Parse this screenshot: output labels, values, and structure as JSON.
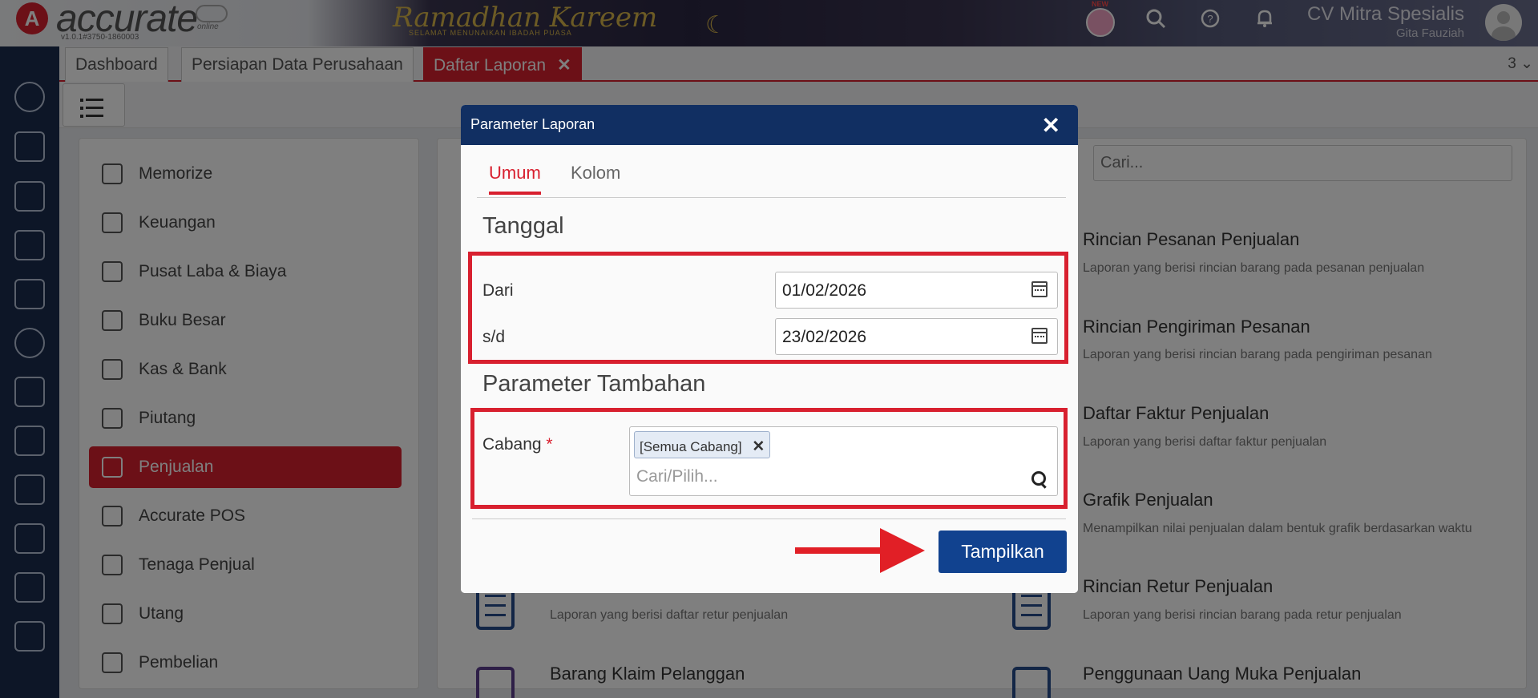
{
  "app": {
    "logo_text": "accurate",
    "logo_sub": "online",
    "version": "v1.0.1#3750-1860003",
    "banner_title": "Ramadhan Kareem",
    "banner_subtitle": "SELAMAT MENUNAIKAN IBADAH PUASA",
    "new_badge": "NEW",
    "company": "CV Mitra Spesialis",
    "user": "Gita Fauziah"
  },
  "tabs": [
    {
      "label": "Dashboard"
    },
    {
      "label": "Persiapan Data Perusahaan"
    },
    {
      "label": "Daftar Laporan"
    }
  ],
  "tab_count": "3 ⌄",
  "sidebar_icons": [
    "settings-icon",
    "cashier-icon",
    "building-icon",
    "book-icon",
    "bank-icon",
    "money-bag-icon",
    "cart-icon",
    "trolley-icon",
    "warehouse-icon",
    "barcode-icon",
    "tax-icon",
    "report-icon"
  ],
  "menu": [
    {
      "label": "Memorize",
      "icon": "save-icon"
    },
    {
      "label": "Keuangan",
      "icon": "money-bag-icon"
    },
    {
      "label": "Pusat Laba & Biaya",
      "icon": "chart-icon"
    },
    {
      "label": "Buku Besar",
      "icon": "ledger-icon"
    },
    {
      "label": "Kas & Bank",
      "icon": "wallet-icon"
    },
    {
      "label": "Piutang",
      "icon": "receivable-icon"
    },
    {
      "label": "Penjualan",
      "icon": "cart-icon"
    },
    {
      "label": "Accurate POS",
      "icon": "pos-icon"
    },
    {
      "label": "Tenaga Penjual",
      "icon": "salesperson-icon"
    },
    {
      "label": "Utang",
      "icon": "payable-icon"
    },
    {
      "label": "Pembelian",
      "icon": "purchase-icon"
    }
  ],
  "search": {
    "placeholder": "Cari..."
  },
  "reports_right": [
    {
      "title": "Rincian Pesanan Penjualan",
      "desc": "Laporan yang berisi rincian barang pada pesanan penjualan"
    },
    {
      "title": "Rincian Pengiriman Pesanan",
      "desc": "Laporan yang berisi rincian barang pada pengiriman pesanan"
    },
    {
      "title": "Daftar Faktur Penjualan",
      "desc": "Laporan yang berisi daftar faktur penjualan"
    },
    {
      "title": "Grafik Penjualan",
      "desc": "Menampilkan nilai penjualan dalam bentuk grafik berdasarkan waktu"
    },
    {
      "title": "Rincian Retur Penjualan",
      "desc": "Laporan yang berisi rincian barang pada retur penjualan"
    },
    {
      "title": "Penggunaan Uang Muka Penjualan",
      "desc": ""
    }
  ],
  "reports_left": [
    {
      "title": "",
      "desc": "Laporan yang berisi daftar retur penjualan"
    },
    {
      "title": "Barang Klaim Pelanggan",
      "desc": ""
    }
  ],
  "modal": {
    "title": "Parameter Laporan",
    "tabs": [
      "Umum",
      "Kolom"
    ],
    "section_date": "Tanggal",
    "from_label": "Dari",
    "from_value": "01/02/2026",
    "to_label": "s/d",
    "to_value": "23/02/2026",
    "section_extra": "Parameter Tambahan",
    "branch_label": "Cabang",
    "branch_required": "*",
    "branch_chip": "[Semua Cabang]",
    "branch_placeholder": "Cari/Pilih...",
    "submit": "Tampilkan"
  },
  "colors": {
    "accent_red": "#d8202f",
    "modal_header": "#112f62",
    "primary_button": "#11428f",
    "sidebar": "#1a2d4f"
  }
}
